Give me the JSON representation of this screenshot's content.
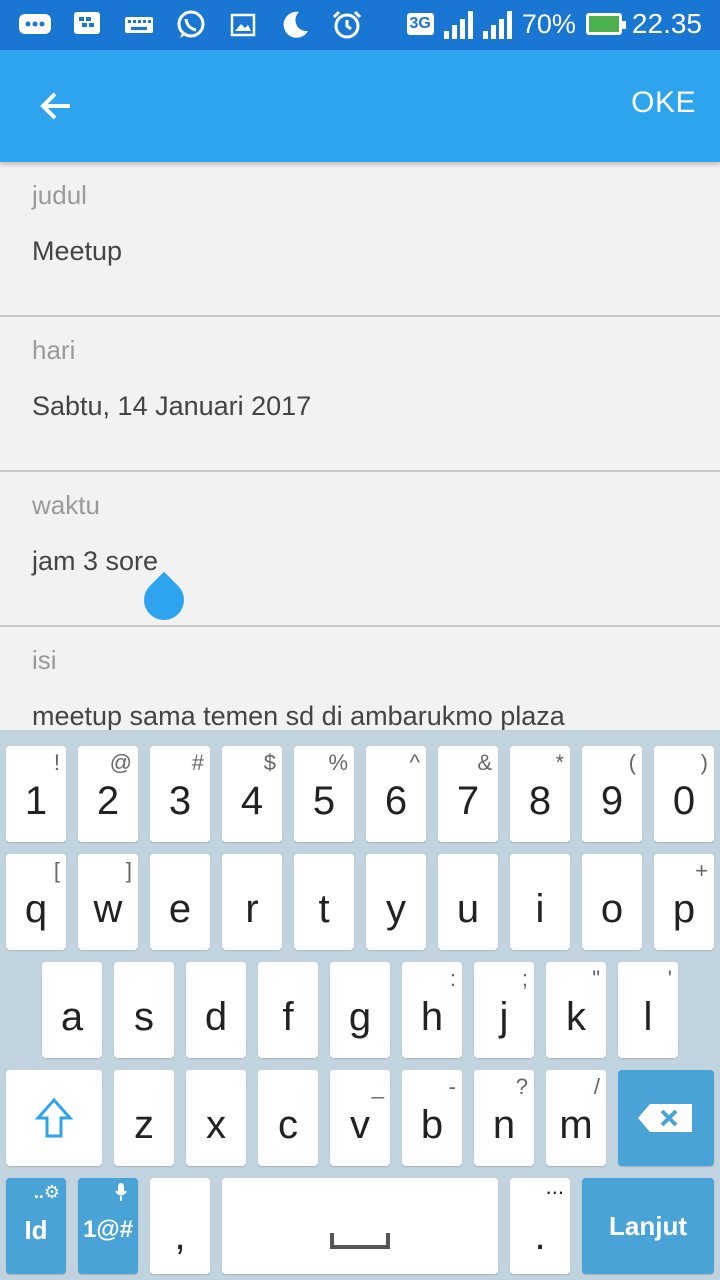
{
  "status_bar": {
    "icons": [
      "bbm-icon",
      "blackberry-icon",
      "keyboard-icon",
      "whatsapp-icon",
      "image-icon",
      "moon-icon",
      "alarm-icon"
    ],
    "network": "3G",
    "battery": "70%",
    "time": "22.35"
  },
  "app_bar": {
    "ok_label": "OKE"
  },
  "form": {
    "fields": [
      {
        "label": "judul",
        "value": "Meetup"
      },
      {
        "label": "hari",
        "value": "Sabtu, 14 Januari 2017"
      },
      {
        "label": "waktu",
        "value": "jam 3 sore"
      },
      {
        "label": "isi",
        "value": "meetup sama temen sd di ambarukmo plaza"
      }
    ]
  },
  "keyboard": {
    "row1": [
      {
        "main": "1",
        "sup": "!"
      },
      {
        "main": "2",
        "sup": "@"
      },
      {
        "main": "3",
        "sup": "#"
      },
      {
        "main": "4",
        "sup": "$"
      },
      {
        "main": "5",
        "sup": "%"
      },
      {
        "main": "6",
        "sup": "^"
      },
      {
        "main": "7",
        "sup": "&"
      },
      {
        "main": "8",
        "sup": "*"
      },
      {
        "main": "9",
        "sup": "("
      },
      {
        "main": "0",
        "sup": ")"
      }
    ],
    "row2": [
      {
        "main": "q",
        "sup": "["
      },
      {
        "main": "w",
        "sup": "]"
      },
      {
        "main": "e",
        "sup": ""
      },
      {
        "main": "r",
        "sup": ""
      },
      {
        "main": "t",
        "sup": ""
      },
      {
        "main": "y",
        "sup": ""
      },
      {
        "main": "u",
        "sup": ""
      },
      {
        "main": "i",
        "sup": ""
      },
      {
        "main": "o",
        "sup": ""
      },
      {
        "main": "p",
        "sup": "+"
      }
    ],
    "row3": [
      {
        "main": "a",
        "sup": ""
      },
      {
        "main": "s",
        "sup": ""
      },
      {
        "main": "d",
        "sup": ""
      },
      {
        "main": "f",
        "sup": ""
      },
      {
        "main": "g",
        "sup": ""
      },
      {
        "main": "h",
        "sup": ":"
      },
      {
        "main": "j",
        "sup": ";"
      },
      {
        "main": "k",
        "sup": "\""
      },
      {
        "main": "l",
        "sup": "'"
      }
    ],
    "row4": [
      {
        "main": "z",
        "sup": ""
      },
      {
        "main": "x",
        "sup": ""
      },
      {
        "main": "c",
        "sup": ""
      },
      {
        "main": "v",
        "sup": "_"
      },
      {
        "main": "b",
        "sup": "-"
      },
      {
        "main": "n",
        "sup": "?"
      },
      {
        "main": "m",
        "sup": "/"
      }
    ],
    "lang_label": "Id",
    "symbols_label": "1@#",
    "comma": ",",
    "period": ".",
    "period_sup": "...",
    "action_label": "Lanjut"
  },
  "colors": {
    "status_bar": "#1976d2",
    "app_bar": "#2ea4ef",
    "keyboard_bg": "#c2d3e0",
    "key_blue": "#4aa3d6"
  }
}
